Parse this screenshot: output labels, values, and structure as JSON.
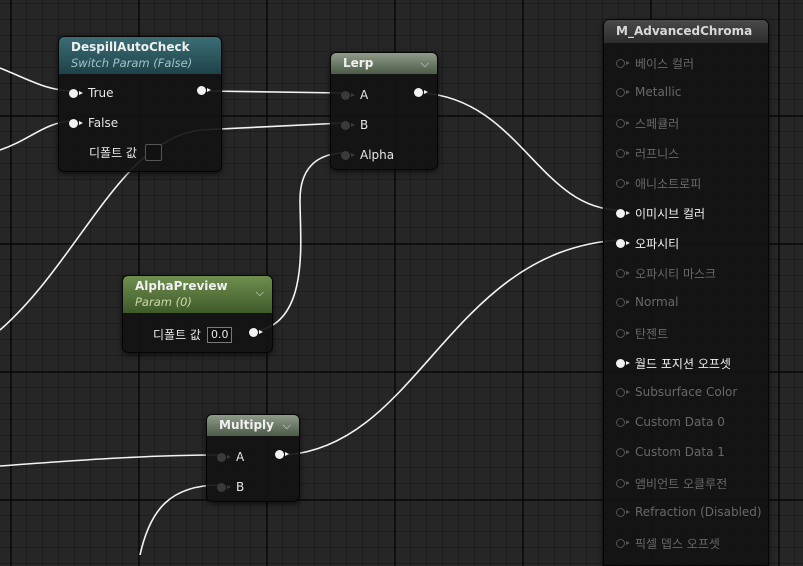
{
  "nodes": {
    "despill": {
      "title": "DespillAutoCheck",
      "subtitle": "Switch Param (False)",
      "pins": [
        "True",
        "False"
      ],
      "default_label": "디폴트 값"
    },
    "lerp": {
      "title": "Lerp",
      "pins": [
        "A",
        "B",
        "Alpha"
      ]
    },
    "alphapreview": {
      "title": "AlphaPreview",
      "subtitle": "Param (0)",
      "default_label": "디폴트 값",
      "default_value": "0.0"
    },
    "multiply": {
      "title": "Multiply",
      "pins": [
        "A",
        "B"
      ]
    },
    "material": {
      "title": "M_AdvancedChroma",
      "outputs": [
        {
          "label": "베이스 컬러",
          "active": false
        },
        {
          "label": "Metallic",
          "active": false
        },
        {
          "label": "스페큘러",
          "active": false
        },
        {
          "label": "러프니스",
          "active": false
        },
        {
          "label": "애니소트로피",
          "active": false
        },
        {
          "label": "이미시브 컬러",
          "active": true
        },
        {
          "label": "오파시티",
          "active": true
        },
        {
          "label": "오파시티 마스크",
          "active": false
        },
        {
          "label": "Normal",
          "active": false
        },
        {
          "label": "탄젠트",
          "active": false
        },
        {
          "label": "월드 포지션 오프셋",
          "active": true
        },
        {
          "label": "Subsurface Color",
          "active": false
        },
        {
          "label": "Custom Data 0",
          "active": false
        },
        {
          "label": "Custom Data 1",
          "active": false
        },
        {
          "label": "앰비언트 오클루전",
          "active": false
        },
        {
          "label": "Refraction (Disabled)",
          "active": false
        },
        {
          "label": "픽셀 뎁스 오프셋",
          "active": false
        }
      ]
    }
  },
  "icons": {
    "collapse": "chevron-down-icon",
    "pin": "exec-pin-icon"
  },
  "colors": {
    "wire": "#ffffff",
    "switch_header": "#2f5a61",
    "param_header": "#5e7d40",
    "math_header": "#6f7d6a",
    "material_header": "#3a3a3a"
  }
}
